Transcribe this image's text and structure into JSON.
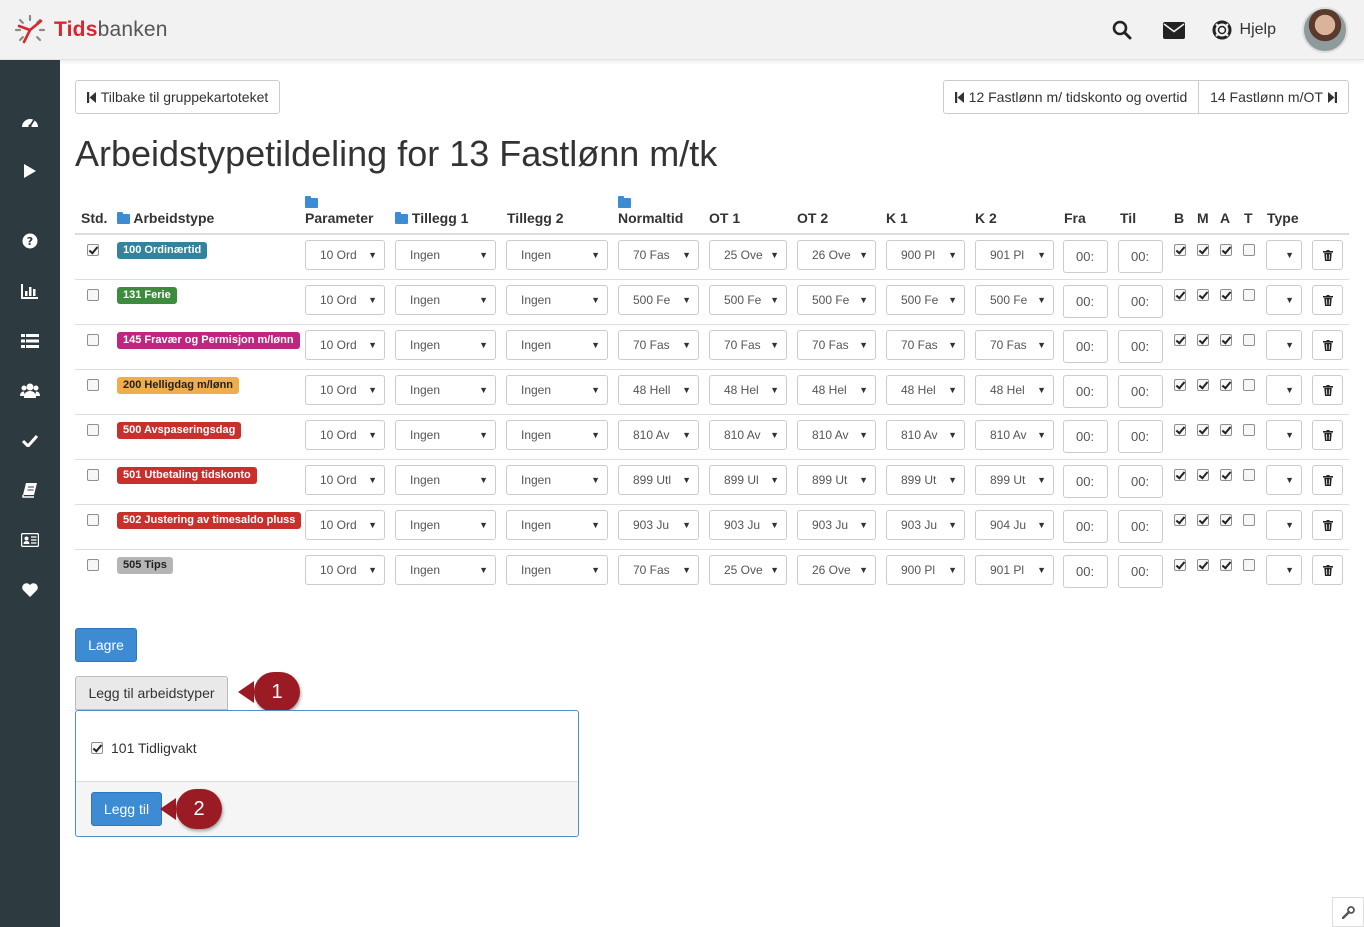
{
  "app": {
    "logo_brand": "Tids",
    "logo_rest": "banken",
    "help_label": "Hjelp"
  },
  "nav": {
    "back_label": "Tilbake til gruppekartoteket",
    "prev_label": "12 Fastlønn m/ tidskonto og overtid",
    "next_label": "14 Fastlønn m/OT"
  },
  "page": {
    "title": "Arbeidstypetildeling for 13 Fastlønn m/tk"
  },
  "table": {
    "headers": {
      "std": "Std.",
      "arbeidstype": "Arbeidstype",
      "parameter": "Parameter",
      "tillegg1": "Tillegg 1",
      "tillegg2": "Tillegg 2",
      "normaltid": "Normaltid",
      "ot1": "OT 1",
      "ot2": "OT 2",
      "k1": "K 1",
      "k2": "K 2",
      "fra": "Fra",
      "til": "Til",
      "b": "B",
      "m": "M",
      "a": "A",
      "t": "T",
      "type": "Type"
    },
    "rows": [
      {
        "std": true,
        "label": "100 Ordinærtid",
        "color": "#31849b",
        "parameter": "10 Ord",
        "tillegg1": "Ingen",
        "tillegg2": "Ingen",
        "normaltid": "70 Fas",
        "ot1": "25 Ove",
        "ot2": "26 Ove",
        "k1": "900 Pl",
        "k2": "901 Pl",
        "fra": "00:",
        "til": "00:",
        "b": true,
        "m": true,
        "a": true,
        "t": false,
        "type": ""
      },
      {
        "std": false,
        "label": "131 Ferie",
        "color": "#3d8b3d",
        "parameter": "10 Ord",
        "tillegg1": "Ingen",
        "tillegg2": "Ingen",
        "normaltid": "500 Fe",
        "ot1": "500 Fe",
        "ot2": "500 Fe",
        "k1": "500 Fe",
        "k2": "500 Fe",
        "fra": "00:",
        "til": "00:",
        "b": true,
        "m": true,
        "a": true,
        "t": false,
        "type": ""
      },
      {
        "std": false,
        "label": "145 Fravær og Permisjon m/lønn",
        "color": "#c0267d",
        "parameter": "10 Ord",
        "tillegg1": "Ingen",
        "tillegg2": "Ingen",
        "normaltid": "70 Fas",
        "ot1": "70 Fas",
        "ot2": "70 Fas",
        "k1": "70 Fas",
        "k2": "70 Fas",
        "fra": "00:",
        "til": "00:",
        "b": true,
        "m": true,
        "a": true,
        "t": false,
        "type": ""
      },
      {
        "std": false,
        "label": "200 Helligdag m/lønn",
        "color": "#f0ad4e",
        "dark_text": true,
        "parameter": "10 Ord",
        "tillegg1": "Ingen",
        "tillegg2": "Ingen",
        "normaltid": "48 Hell",
        "ot1": "48 Hel",
        "ot2": "48 Hel",
        "k1": "48 Hel",
        "k2": "48 Hel",
        "fra": "00:",
        "til": "00:",
        "b": true,
        "m": true,
        "a": true,
        "t": false,
        "type": ""
      },
      {
        "std": false,
        "label": "500 Avspaseringsdag",
        "color": "#c9302c",
        "parameter": "10 Ord",
        "tillegg1": "Ingen",
        "tillegg2": "Ingen",
        "normaltid": "810 Av",
        "ot1": "810 Av",
        "ot2": "810 Av",
        "k1": "810 Av",
        "k2": "810 Av",
        "fra": "00:",
        "til": "00:",
        "b": true,
        "m": true,
        "a": true,
        "t": false,
        "type": ""
      },
      {
        "std": false,
        "label": "501 Utbetaling tidskonto",
        "color": "#c9302c",
        "parameter": "10 Ord",
        "tillegg1": "Ingen",
        "tillegg2": "Ingen",
        "normaltid": "899 Utl",
        "ot1": "899 Ul",
        "ot2": "899 Ut",
        "k1": "899 Ut",
        "k2": "899 Ut",
        "fra": "00:",
        "til": "00:",
        "b": true,
        "m": true,
        "a": true,
        "t": false,
        "type": ""
      },
      {
        "std": false,
        "label": "502 Justering av timesaldo pluss",
        "color": "#c9302c",
        "parameter": "10 Ord",
        "tillegg1": "Ingen",
        "tillegg2": "Ingen",
        "normaltid": "903 Ju",
        "ot1": "903 Ju",
        "ot2": "903 Ju",
        "k1": "903 Ju",
        "k2": "904 Ju",
        "fra": "00:",
        "til": "00:",
        "b": true,
        "m": true,
        "a": true,
        "t": false,
        "type": ""
      },
      {
        "std": false,
        "label": "505 Tips",
        "color": "#b5b5b5",
        "dark_text": true,
        "parameter": "10 Ord",
        "tillegg1": "Ingen",
        "tillegg2": "Ingen",
        "normaltid": "70 Fas",
        "ot1": "25 Ove",
        "ot2": "26 Ove",
        "k1": "900 Pl",
        "k2": "901 Pl",
        "fra": "00:",
        "til": "00:",
        "b": true,
        "m": true,
        "a": true,
        "t": false,
        "type": ""
      }
    ]
  },
  "actions": {
    "save_label": "Lagre",
    "add_types_label": "Legg til arbeidstyper",
    "add_label": "Legg til"
  },
  "add_panel": {
    "items": [
      {
        "label": "101 Tidligvakt",
        "checked": true
      }
    ]
  },
  "callouts": {
    "one": "1",
    "two": "2"
  },
  "colors": {
    "primary": "#3c8bd3",
    "sidebar": "#2d3a40",
    "callout": "#9b1b24",
    "brand_red": "#d9262c"
  }
}
